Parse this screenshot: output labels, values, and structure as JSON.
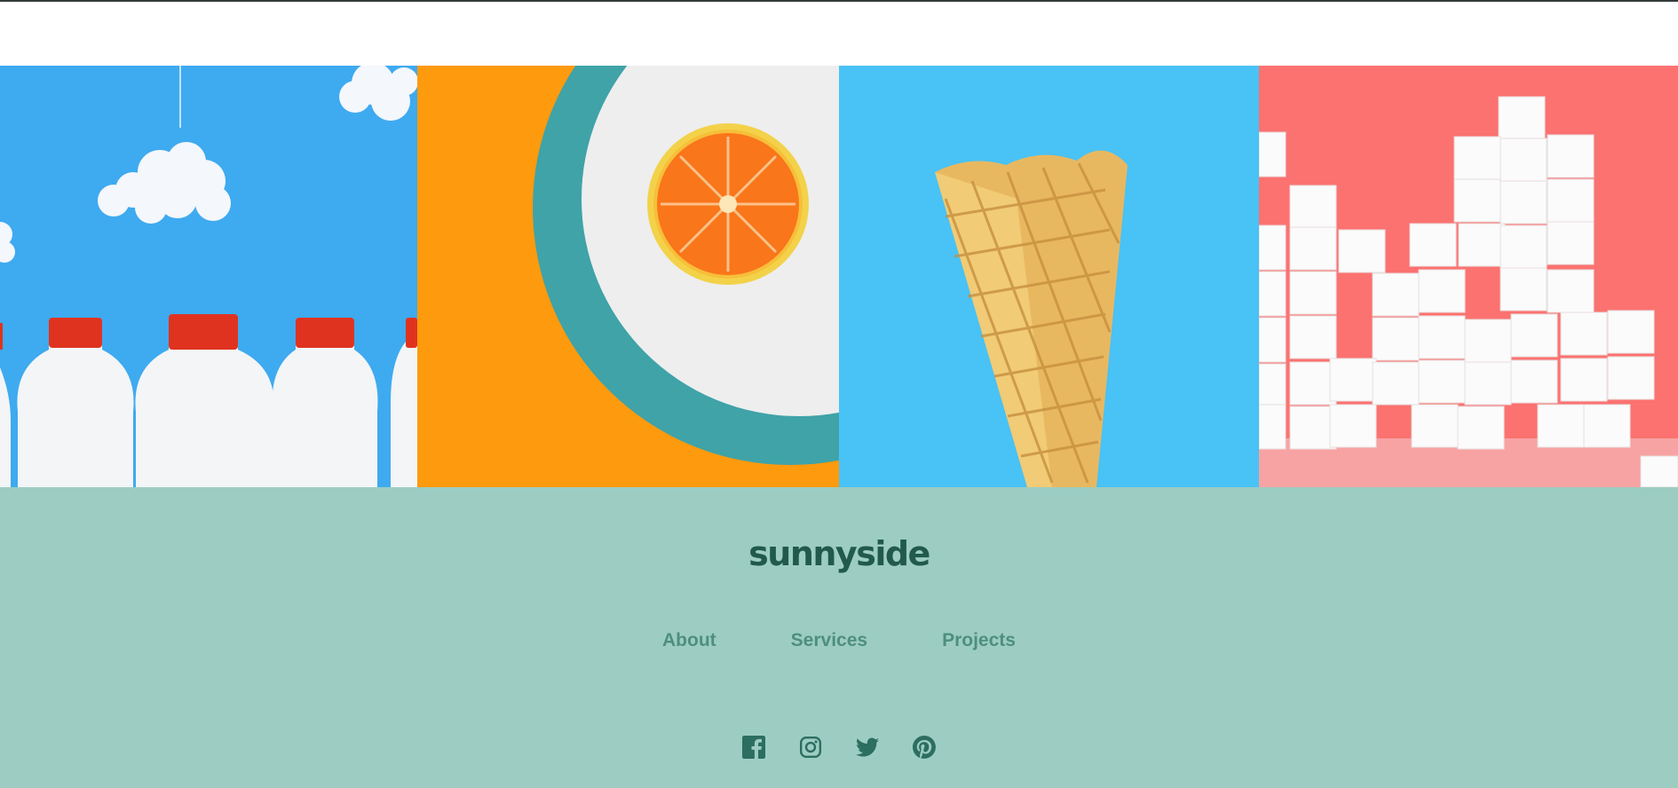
{
  "gallery": {
    "images": [
      {
        "name": "milk-bottles",
        "alt": "Milk bottles with red caps under clouds"
      },
      {
        "name": "orange-on-plate",
        "alt": "Orange slice on a white plate"
      },
      {
        "name": "ice-cream-cone",
        "alt": "Empty waffle cone"
      },
      {
        "name": "sugar-cubes",
        "alt": "Stacked sugar cubes"
      }
    ]
  },
  "footer": {
    "logo": "sunnyside",
    "nav": [
      {
        "label": "About"
      },
      {
        "label": "Services"
      },
      {
        "label": "Projects"
      }
    ],
    "socials": [
      {
        "icon": "facebook-icon"
      },
      {
        "icon": "instagram-icon"
      },
      {
        "icon": "twitter-icon"
      },
      {
        "icon": "pinterest-icon"
      }
    ]
  },
  "colors": {
    "footer_bg": "#9dcdc2",
    "logo": "#215a4d",
    "nav_link": "#4e8f7e",
    "social_icon": "#2c6e5f"
  }
}
